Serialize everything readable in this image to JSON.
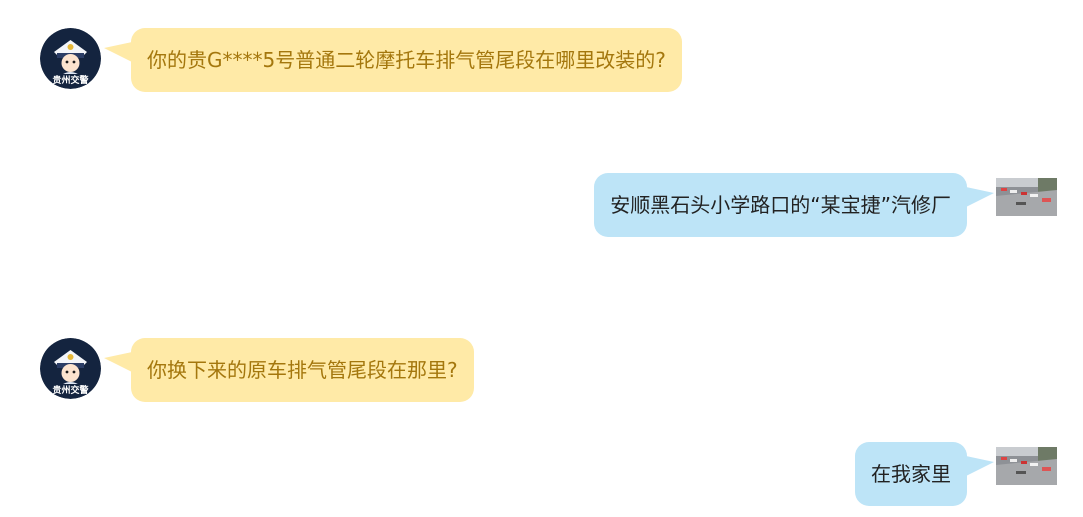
{
  "messages": [
    {
      "side": "left",
      "avatar": {
        "icon": "police-cartoon-avatar-icon",
        "badge_text": "贵州交警"
      },
      "text": "你的贵G****5号普通二轮摩托车排气管尾段在哪里改装的?"
    },
    {
      "side": "right",
      "avatar": {
        "icon": "street-photo-avatar-icon"
      },
      "text": "安顺黑石头小学路口的“某宝捷”汽修厂"
    },
    {
      "side": "left",
      "avatar": {
        "icon": "police-cartoon-avatar-icon",
        "badge_text": "贵州交警"
      },
      "text": "你换下来的原车排气管尾段在那里?"
    },
    {
      "side": "right",
      "avatar": {
        "icon": "street-photo-avatar-icon"
      },
      "text": "在我家里"
    }
  ],
  "colors": {
    "left_bubble_bg": "#ffeaa7",
    "left_text": "#a4770d",
    "right_bubble_bg": "#bde4f7",
    "right_text": "#222222",
    "avatar_navy": "#14243f"
  }
}
